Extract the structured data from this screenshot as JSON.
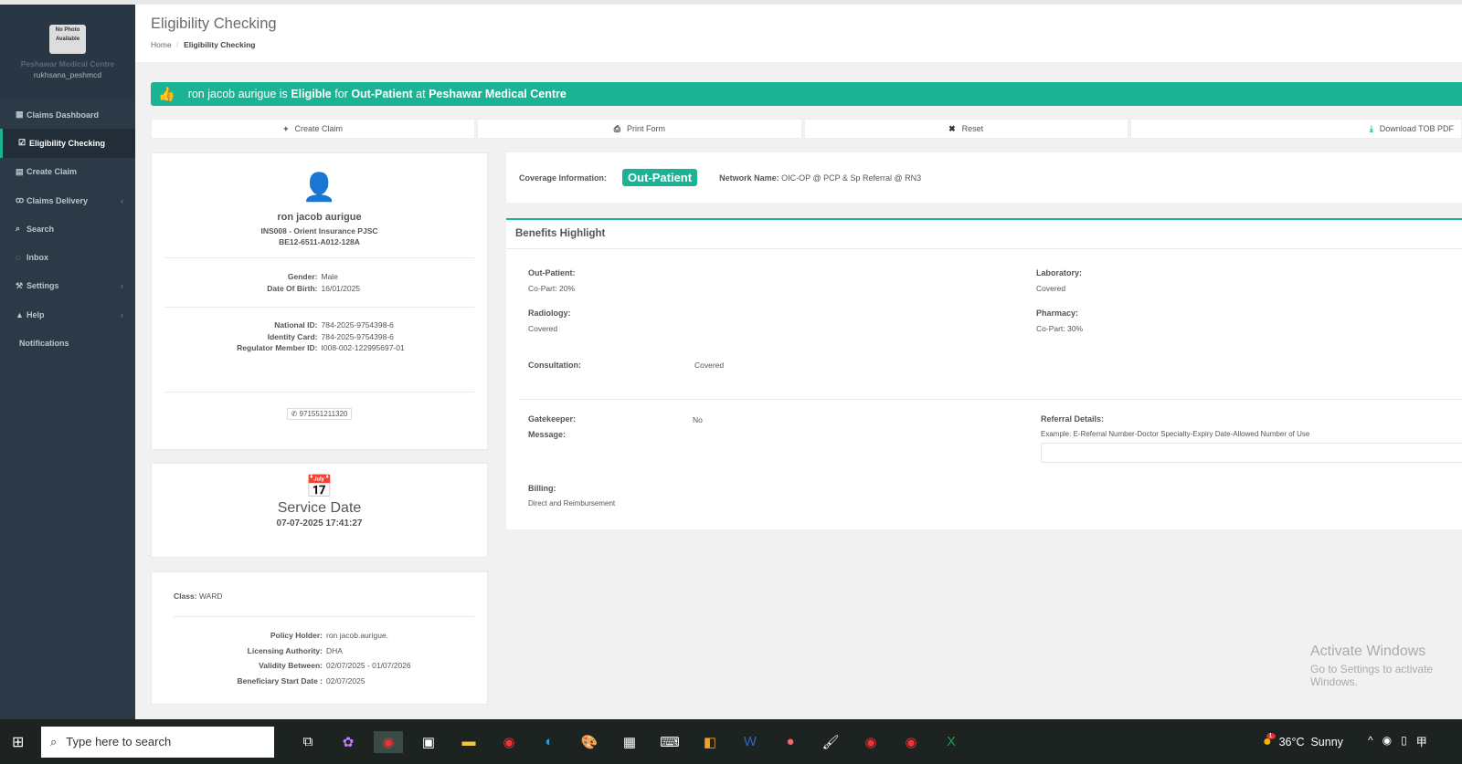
{
  "sidebar": {
    "photo": "No Photo Available",
    "org": "Peshawar Medical Centre",
    "user": "rukhsana_peshmcd",
    "items": [
      {
        "label": "Claims Dashboard",
        "icon": "th-large-icon"
      },
      {
        "label": "Eligibility Checking",
        "icon": "check-square-icon"
      },
      {
        "label": "Create Claim",
        "icon": "list-alt-icon"
      },
      {
        "label": "Claims Delivery",
        "icon": "bicycle-icon"
      },
      {
        "label": "Search",
        "icon": "search-icon"
      },
      {
        "label": "Inbox",
        "icon": "comments-icon"
      },
      {
        "label": "Settings",
        "icon": "wrench-icon"
      },
      {
        "label": "Help",
        "icon": "warning-icon"
      },
      {
        "label": "Notifications"
      }
    ]
  },
  "header": {
    "title": "Eligibility Checking",
    "crumbs": [
      "Home",
      "Eligibility Checking"
    ]
  },
  "banner": {
    "name": "ron jacob aurigue",
    "is": "is",
    "status": "Eligible",
    "for": "for",
    "type": "Out-Patient",
    "at": "at",
    "facility": "Peshawar Medical Centre",
    "color": "#1ab394"
  },
  "actions": {
    "create": "Create Claim",
    "print": "Print Form",
    "reset": "Reset",
    "download": "Download TOB PDF"
  },
  "member": {
    "name": "ron jacob aurigue",
    "insurer": "INS008 - Orient Insurance PJSC",
    "card": "BE12-6511-A012-128A",
    "gender_label": "Gender:",
    "gender": "Male",
    "dob_label": "Date Of Birth:",
    "dob": "16/01/2025",
    "nid_label": "National ID:",
    "nid": "784-2025-9754398-6",
    "idc_label": "Identity Card:",
    "idc": "784-2025-9754398-6",
    "reg_label": "Regulator Member ID:",
    "reg": "I008-002-122995697-01",
    "phone": "971551211320"
  },
  "service": {
    "title": "Service Date",
    "date": "07-07-2025 17:41:27"
  },
  "policy": {
    "class_label": "Class:",
    "class": "WARD",
    "holder_label": "Policy Holder:",
    "holder": "ron jacob.aurigue.",
    "auth_label": "Licensing Authority:",
    "auth": "DHA",
    "valid_label": "Validity Between:",
    "valid": "02/07/2025 - 01/07/2026",
    "start_label": "Beneficiary Start Date :",
    "start": "02/07/2025"
  },
  "coverage": {
    "label": "Coverage Information:",
    "badge": "Out-Patient",
    "network_label": "Network Name:",
    "network": "OIC-OP @ PCP & Sp Referral @ RN3"
  },
  "benefits": {
    "title": "Benefits Highlight",
    "op_label": "Out-Patient:",
    "op": "Co-Part: 20%",
    "lab_label": "Laboratory:",
    "lab": "Covered",
    "rad_label": "Radiology:",
    "rad": "Covered",
    "ph_label": "Pharmacy:",
    "ph": "Co-Part: 30%",
    "cons_label": "Consultation:",
    "cons": "Covered",
    "gk_label": "Gatekeeper:",
    "gk": "No",
    "msg_label": "Message:",
    "ref_label": "Referral Details:",
    "ref_hint": "Example: E-Referral Number-Doctor Specialty-Expiry Date-Allowed Number of Use",
    "ref_value": "",
    "bill_label": "Billing:",
    "bill": "Direct and Reimbursement"
  },
  "watermark": {
    "line1": "Activate Windows",
    "line2": "Go to Settings to activate Windows."
  },
  "taskbar": {
    "search": "Type here to search",
    "temp": "36°C",
    "weather": "Sunny",
    "badge": "1"
  }
}
